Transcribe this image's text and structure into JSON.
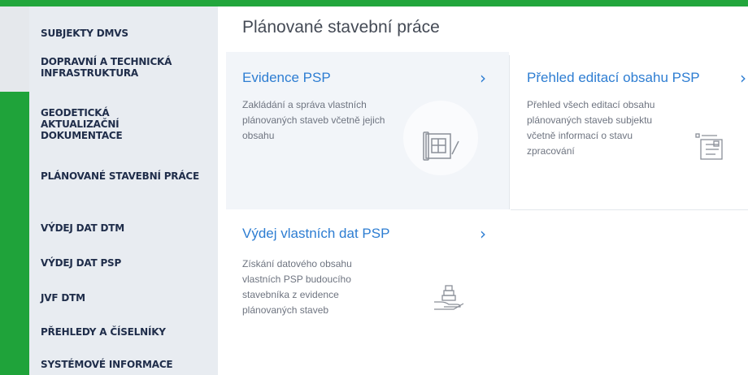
{
  "sidebar": {
    "items": [
      {
        "label": "SUBJEKTY DMVS"
      },
      {
        "label": "DOPRAVNÍ A TECHNICKÁ INFRASTRUKTURA"
      },
      {
        "label": "GEODETICKÁ AKTUALIZAČNÍ DOKUMENTACE"
      },
      {
        "label": "PLÁNOVANÉ STAVEBNÍ PRÁCE"
      },
      {
        "label": "VÝDEJ DAT DTM"
      },
      {
        "label": "VÝDEJ DAT PSP"
      },
      {
        "label": "JVF DTM"
      },
      {
        "label": "PŘEHLEDY A ČÍSELNÍKY"
      },
      {
        "label": "SYSTÉMOVÉ INFORMACE"
      }
    ]
  },
  "main": {
    "title": "Plánované stavební práce",
    "cards": [
      {
        "title": "Evidence PSP",
        "description": "Zakládání a správa vlastních plánovaných staveb včetně jejich obsahu",
        "icon": "blueprint-icon"
      },
      {
        "title": "Přehled editací obsahu PSP",
        "description": "Přehled všech editací obsahu plánovaných staveb subjektu včetně informací o stavu zpracování",
        "icon": "checklist-icon"
      },
      {
        "title": "Výdej vlastních dat PSP",
        "description": "Získání datového obsahu vlastních PSP budoucího stavebníka z evidence plánovaných staveb",
        "icon": "hand-data-icon"
      }
    ]
  },
  "colors": {
    "accent_green": "#22a63c",
    "link_blue": "#2d7dd2",
    "sidebar_bg": "#e8ecf1",
    "nav_text": "#1f2d4a",
    "highlight_card_bg": "#f2f5f9"
  }
}
